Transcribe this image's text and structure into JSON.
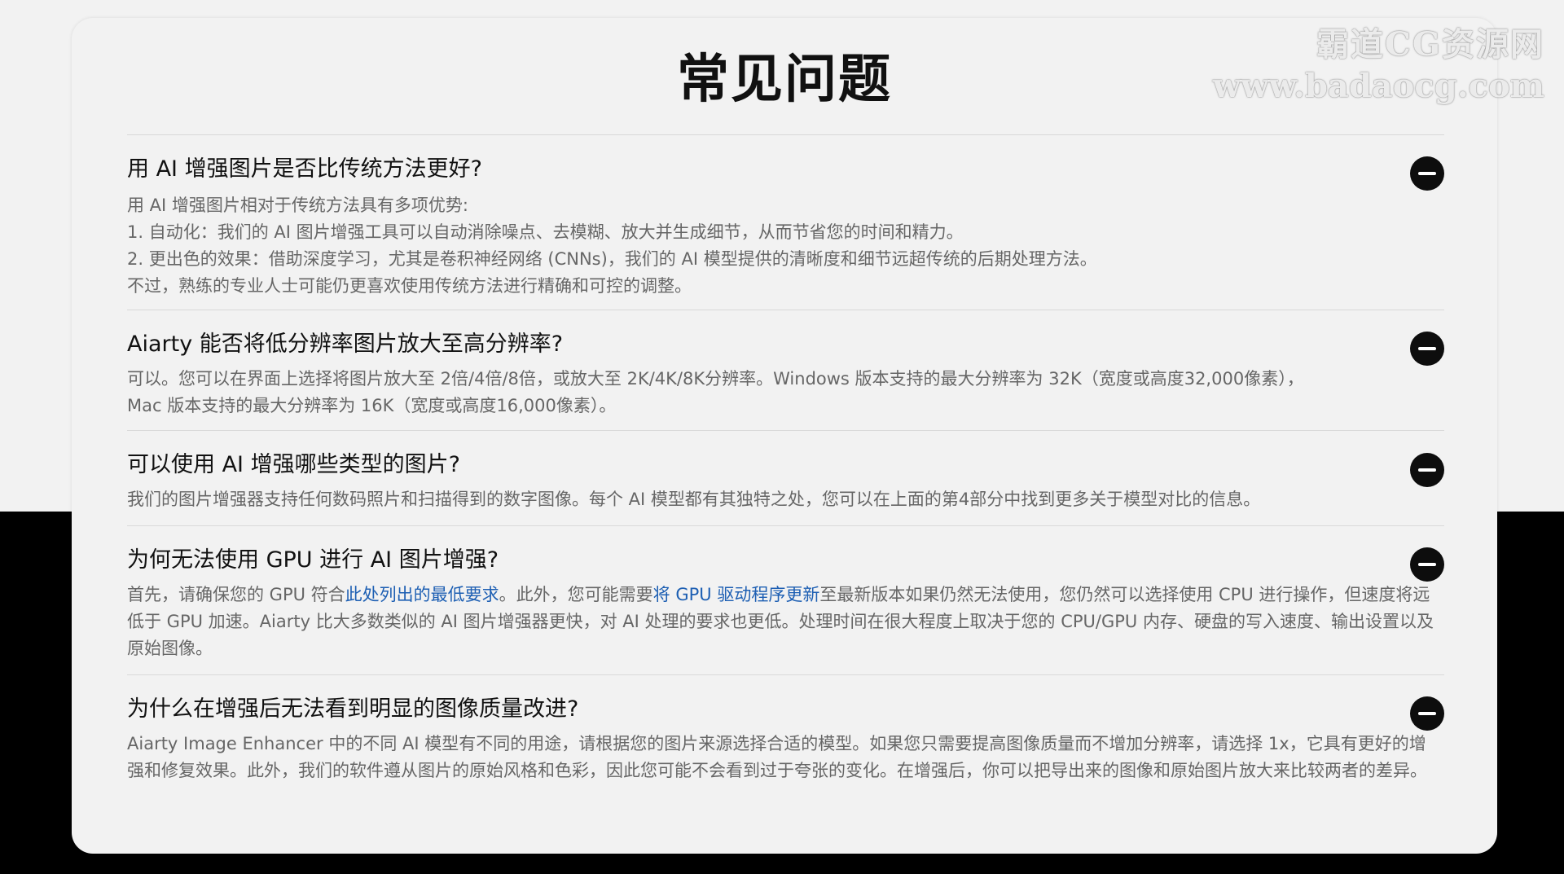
{
  "watermark": {
    "line1": "霸道CG资源网",
    "line2": "www.badaocg.com"
  },
  "page": {
    "title": "常见问题"
  },
  "faqs": [
    {
      "question": "用 AI 增强图片是否比传统方法更好?",
      "answer_lines": [
        "用 AI 增强图片相对于传统方法具有多项优势:",
        "1. 自动化：我们的 AI 图片增强工具可以自动消除噪点、去模糊、放大并生成细节，从而节省您的时间和精力。",
        "2. 更出色的效果：借助深度学习，尤其是卷积神经网络 (CNNs)，我们的 AI 模型提供的清晰度和细节远超传统的后期处理方法。",
        "不过，熟练的专业人士可能仍更喜欢使用传统方法进行精确和可控的调整。"
      ],
      "toggle_icon": "minus-circle-icon"
    },
    {
      "question": "Aiarty 能否将低分辨率图片放大至高分辨率?",
      "answer_lines": [
        "可以。您可以在界面上选择将图片放大至 2倍/4倍/8倍，或放大至 2K/4K/8K分辨率。Windows 版本支持的最大分辨率为 32K（宽度或高度32,000像素），",
        "Mac 版本支持的最大分辨率为 16K（宽度或高度16,000像素）。"
      ],
      "toggle_icon": "minus-circle-icon"
    },
    {
      "question": "可以使用 AI 增强哪些类型的图片?",
      "answer_lines": [
        "我们的图片增强器支持任何数码照片和扫描得到的数字图像。每个 AI 模型都有其独特之处，您可以在上面的第4部分中找到更多关于模型对比的信息。"
      ],
      "toggle_icon": "minus-circle-icon"
    },
    {
      "question": "为何无法使用 GPU 进行 AI 图片增强?",
      "answer": {
        "part1": "首先，请确保您的 GPU 符合",
        "link1": "此处列出的最低要求",
        "part2": "。此外，您可能需要",
        "link2": "将 GPU 驱动程序更新",
        "part3": "至最新版本如果仍然无法使用，您仍然可以选择使用 CPU 进行操作，但速度将远低于 GPU 加速。Aiarty 比大多数类似的 AI 图片增强器更快，对 AI 处理的要求也更低。处理时间在很大程度上取决于您的 CPU/GPU 内存、硬盘的写入速度、输出设置以及原始图像。"
      },
      "link_color": "#1d5fb3",
      "toggle_icon": "minus-circle-icon"
    },
    {
      "question": "为什么在增强后无法看到明显的图像质量改进?",
      "answer_lines": [
        "Aiarty Image Enhancer 中的不同 AI 模型有不同的用途，请根据您的图片来源选择合适的模型。如果您只需要提高图像质量而不增加分辨率，请选择 1x，它具有更好的增强和修复效果。此外，我们的软件遵从图片的原始风格和色彩，因此您可能不会看到过于夸张的变化。在增强后，你可以把导出来的图像和原始图片放大来比较两者的差异。"
      ],
      "toggle_icon": "minus-circle-icon"
    }
  ],
  "colors": {
    "background_top": "#f2f2f2",
    "background_bottom": "#000000",
    "card": "#f2f2f2",
    "question_text": "#111111",
    "answer_text": "#666666",
    "link": "#1d5fb3",
    "toggle_button": "#0d0d0d"
  }
}
